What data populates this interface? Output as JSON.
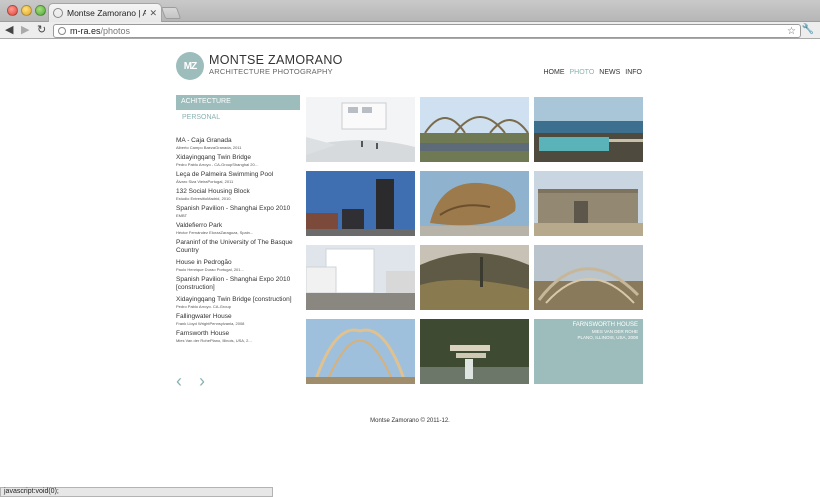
{
  "browser": {
    "tab_title": "Montse Zamorano | Architectu",
    "tab_close": "✕",
    "url_host": "m-ra.es",
    "url_path": "/photos",
    "status_text": "javascript:void(0);"
  },
  "site": {
    "brand_name": "MONTSE ZAMORANO",
    "brand_sub": "ARCHITECTURE PHOTOGRAPHY",
    "logo_text": "MZ",
    "nav": [
      "HOME",
      "PHOTO",
      "NEWS",
      "INFO"
    ],
    "active_nav": "PHOTO"
  },
  "sidebar": {
    "category_active": "ACHITECTURE",
    "category_other": "PERSONAL",
    "projects": [
      {
        "title": "MA - Caja Granada",
        "sub": "Alberto Campo BaezaGranada, 2011"
      },
      {
        "title": "Xidayingqang Twin Bridge",
        "sub": "Pedro Pablo Arroyo - CA-GroupShanghai 20..."
      },
      {
        "title": "Leça de Palmeira Swimming Pool",
        "sub": "Álvaro Siza VieiraPortugal, 2011"
      },
      {
        "title": "132 Social Housing Block",
        "sub": "Estudio EntresitioMadrid, 2010."
      },
      {
        "title": "Spanish Pavilion - Shanghai Expo 2010",
        "sub": "EMBT"
      },
      {
        "title": "Valdefierro Park",
        "sub": "Héctor Fernández ElorzaZaragoza, Spain..."
      },
      {
        "title": "Paraninf of the University of The Basque Country",
        "sub": ""
      },
      {
        "title": "House in Pedrogão",
        "sub": "Paulo Henrique Durao Portugal, 201..."
      },
      {
        "title": "Spanish Pavilion - Shanghai Expo 2010 [construction]",
        "sub": ""
      },
      {
        "title": "Xidayingqang Twin Bridge [construction]",
        "sub": "Pedro Pablo Arroyo. CA-Group"
      },
      {
        "title": "Fallingwater House",
        "sub": "Frank Lloyd WrightPennsylvania, 2008"
      },
      {
        "title": "Farnsworth House",
        "sub": "Mies Van der RohePlano, Illinois, USA, 2..."
      }
    ],
    "prev_arrow": "‹",
    "next_arrow": "›"
  },
  "info_tile": {
    "title": "FARNSWORTH HOUSE",
    "line2": "MIES VAN DER ROHE",
    "line3": "PLANO, ILLINOIS, USA, 2008"
  },
  "footer": "Montse Zamorano © 2011-12."
}
